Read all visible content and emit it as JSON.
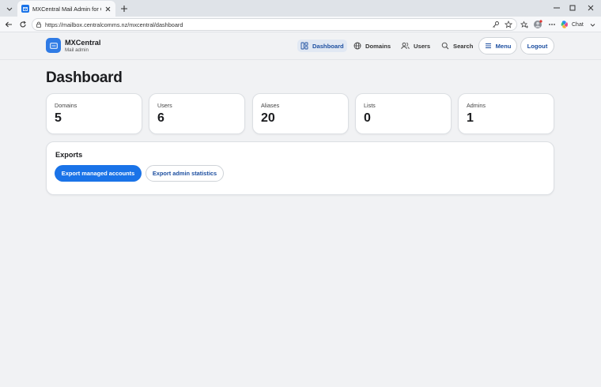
{
  "browser": {
    "tab_title": "MXCentral Mail Admin for CCL",
    "url": "https://mailbox.centralcomms.nz/mxcentral/dashboard",
    "chat_label": "Chat"
  },
  "header": {
    "brand_name": "MXCentral",
    "brand_subtitle": "Mail admin",
    "nav": [
      {
        "label": "Dashboard",
        "icon": "dashboard-icon",
        "active": true
      },
      {
        "label": "Domains",
        "icon": "globe-icon",
        "active": false
      },
      {
        "label": "Users",
        "icon": "users-icon",
        "active": false
      },
      {
        "label": "Search",
        "icon": "search-icon",
        "active": false
      }
    ],
    "menu_label": "Menu",
    "logout_label": "Logout"
  },
  "main": {
    "title": "Dashboard",
    "stats": [
      {
        "label": "Domains",
        "value": "5"
      },
      {
        "label": "Users",
        "value": "6"
      },
      {
        "label": "Aliases",
        "value": "20"
      },
      {
        "label": "Lists",
        "value": "0"
      },
      {
        "label": "Admins",
        "value": "1"
      }
    ],
    "exports": {
      "title": "Exports",
      "primary_label": "Export managed accounts",
      "secondary_label": "Export admin statistics"
    }
  },
  "colors": {
    "accent": "#1a73e8",
    "active_nav_bg": "#e1e8f3",
    "page_bg": "#f1f2f4"
  }
}
